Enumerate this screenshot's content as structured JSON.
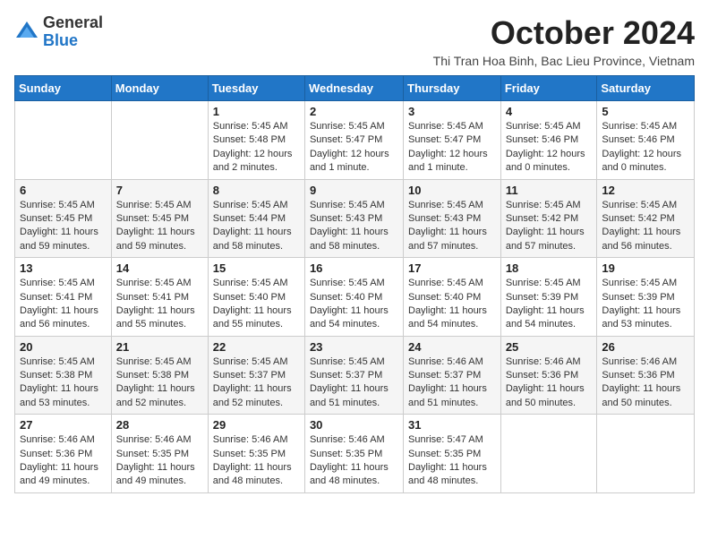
{
  "logo": {
    "general": "General",
    "blue": "Blue"
  },
  "header": {
    "month": "October 2024",
    "subtitle": "Thi Tran Hoa Binh, Bac Lieu Province, Vietnam"
  },
  "days": [
    "Sunday",
    "Monday",
    "Tuesday",
    "Wednesday",
    "Thursday",
    "Friday",
    "Saturday"
  ],
  "weeks": [
    [
      {
        "day": "",
        "content": ""
      },
      {
        "day": "",
        "content": ""
      },
      {
        "day": "1",
        "content": "Sunrise: 5:45 AM\nSunset: 5:48 PM\nDaylight: 12 hours and 2 minutes."
      },
      {
        "day": "2",
        "content": "Sunrise: 5:45 AM\nSunset: 5:47 PM\nDaylight: 12 hours and 1 minute."
      },
      {
        "day": "3",
        "content": "Sunrise: 5:45 AM\nSunset: 5:47 PM\nDaylight: 12 hours and 1 minute."
      },
      {
        "day": "4",
        "content": "Sunrise: 5:45 AM\nSunset: 5:46 PM\nDaylight: 12 hours and 0 minutes."
      },
      {
        "day": "5",
        "content": "Sunrise: 5:45 AM\nSunset: 5:46 PM\nDaylight: 12 hours and 0 minutes."
      }
    ],
    [
      {
        "day": "6",
        "content": "Sunrise: 5:45 AM\nSunset: 5:45 PM\nDaylight: 11 hours and 59 minutes."
      },
      {
        "day": "7",
        "content": "Sunrise: 5:45 AM\nSunset: 5:45 PM\nDaylight: 11 hours and 59 minutes."
      },
      {
        "day": "8",
        "content": "Sunrise: 5:45 AM\nSunset: 5:44 PM\nDaylight: 11 hours and 58 minutes."
      },
      {
        "day": "9",
        "content": "Sunrise: 5:45 AM\nSunset: 5:43 PM\nDaylight: 11 hours and 58 minutes."
      },
      {
        "day": "10",
        "content": "Sunrise: 5:45 AM\nSunset: 5:43 PM\nDaylight: 11 hours and 57 minutes."
      },
      {
        "day": "11",
        "content": "Sunrise: 5:45 AM\nSunset: 5:42 PM\nDaylight: 11 hours and 57 minutes."
      },
      {
        "day": "12",
        "content": "Sunrise: 5:45 AM\nSunset: 5:42 PM\nDaylight: 11 hours and 56 minutes."
      }
    ],
    [
      {
        "day": "13",
        "content": "Sunrise: 5:45 AM\nSunset: 5:41 PM\nDaylight: 11 hours and 56 minutes."
      },
      {
        "day": "14",
        "content": "Sunrise: 5:45 AM\nSunset: 5:41 PM\nDaylight: 11 hours and 55 minutes."
      },
      {
        "day": "15",
        "content": "Sunrise: 5:45 AM\nSunset: 5:40 PM\nDaylight: 11 hours and 55 minutes."
      },
      {
        "day": "16",
        "content": "Sunrise: 5:45 AM\nSunset: 5:40 PM\nDaylight: 11 hours and 54 minutes."
      },
      {
        "day": "17",
        "content": "Sunrise: 5:45 AM\nSunset: 5:40 PM\nDaylight: 11 hours and 54 minutes."
      },
      {
        "day": "18",
        "content": "Sunrise: 5:45 AM\nSunset: 5:39 PM\nDaylight: 11 hours and 54 minutes."
      },
      {
        "day": "19",
        "content": "Sunrise: 5:45 AM\nSunset: 5:39 PM\nDaylight: 11 hours and 53 minutes."
      }
    ],
    [
      {
        "day": "20",
        "content": "Sunrise: 5:45 AM\nSunset: 5:38 PM\nDaylight: 11 hours and 53 minutes."
      },
      {
        "day": "21",
        "content": "Sunrise: 5:45 AM\nSunset: 5:38 PM\nDaylight: 11 hours and 52 minutes."
      },
      {
        "day": "22",
        "content": "Sunrise: 5:45 AM\nSunset: 5:37 PM\nDaylight: 11 hours and 52 minutes."
      },
      {
        "day": "23",
        "content": "Sunrise: 5:45 AM\nSunset: 5:37 PM\nDaylight: 11 hours and 51 minutes."
      },
      {
        "day": "24",
        "content": "Sunrise: 5:46 AM\nSunset: 5:37 PM\nDaylight: 11 hours and 51 minutes."
      },
      {
        "day": "25",
        "content": "Sunrise: 5:46 AM\nSunset: 5:36 PM\nDaylight: 11 hours and 50 minutes."
      },
      {
        "day": "26",
        "content": "Sunrise: 5:46 AM\nSunset: 5:36 PM\nDaylight: 11 hours and 50 minutes."
      }
    ],
    [
      {
        "day": "27",
        "content": "Sunrise: 5:46 AM\nSunset: 5:36 PM\nDaylight: 11 hours and 49 minutes."
      },
      {
        "day": "28",
        "content": "Sunrise: 5:46 AM\nSunset: 5:35 PM\nDaylight: 11 hours and 49 minutes."
      },
      {
        "day": "29",
        "content": "Sunrise: 5:46 AM\nSunset: 5:35 PM\nDaylight: 11 hours and 48 minutes."
      },
      {
        "day": "30",
        "content": "Sunrise: 5:46 AM\nSunset: 5:35 PM\nDaylight: 11 hours and 48 minutes."
      },
      {
        "day": "31",
        "content": "Sunrise: 5:47 AM\nSunset: 5:35 PM\nDaylight: 11 hours and 48 minutes."
      },
      {
        "day": "",
        "content": ""
      },
      {
        "day": "",
        "content": ""
      }
    ]
  ]
}
